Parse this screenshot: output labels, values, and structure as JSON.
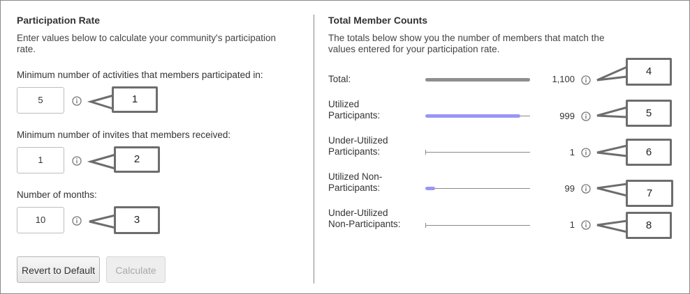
{
  "left": {
    "title": "Participation Rate",
    "description": "Enter values below to calculate your community's participation rate.",
    "fields": [
      {
        "label": "Minimum number of activities that members participated in:",
        "value": "5"
      },
      {
        "label": "Minimum number of invites that members received:",
        "value": "1"
      },
      {
        "label": "Number of months:",
        "value": "10"
      }
    ],
    "buttons": {
      "revert": "Revert to Default",
      "calculate": "Calculate"
    }
  },
  "right": {
    "title": "Total Member Counts",
    "description": "The totals below show you the number of members that match the values entered for your participation rate.",
    "rows": [
      {
        "label_line1": "Total:",
        "label_line2": "",
        "count": "1,100",
        "fraction": 1.0,
        "color": "#8e8e8e"
      },
      {
        "label_line1": "Utilized",
        "label_line2": "Participants:",
        "count": "999",
        "fraction": 0.908,
        "color": "#9b96f5"
      },
      {
        "label_line1": "Under-Utilized",
        "label_line2": "Participants:",
        "count": "1",
        "fraction": 0.0,
        "color": "#9b96f5"
      },
      {
        "label_line1": "Utilized Non-",
        "label_line2": "Participants:",
        "count": "99",
        "fraction": 0.09,
        "color": "#9b96f5"
      },
      {
        "label_line1": "Under-Utilized",
        "label_line2": "Non-Participants:",
        "count": "1",
        "fraction": 0.0,
        "color": "#9b96f5"
      }
    ]
  },
  "callouts": [
    "1",
    "2",
    "3",
    "4",
    "5",
    "6",
    "7",
    "8"
  ],
  "icons": {
    "info": "info-circle-icon"
  },
  "colors": {
    "callout_border": "#6d6d6d",
    "accent_bar": "#9b96f5",
    "total_bar": "#8e8e8e"
  }
}
